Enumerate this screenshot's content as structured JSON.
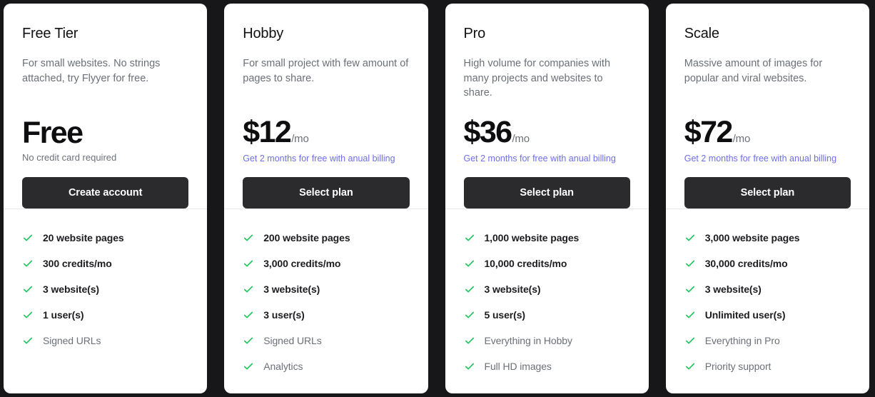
{
  "theme": {
    "page_background": "#17171a",
    "card_background": "#ffffff",
    "button_background": "#2b2b2e",
    "check_color": "#22c55e",
    "link_color": "#6e6ee8",
    "muted_text": "#6b7078",
    "strong_text": "#1c1c20"
  },
  "plans": [
    {
      "name": "Free Tier",
      "description": "For small websites. No strings attached, try Flyyer for free.",
      "price": "Free",
      "period": "",
      "note": "No credit card required",
      "note_style": "muted",
      "cta": "Create account",
      "features": [
        {
          "label": "20 website pages",
          "emphasis": "strong"
        },
        {
          "label": "300 credits/mo",
          "emphasis": "strong"
        },
        {
          "label": "3 website(s)",
          "emphasis": "strong"
        },
        {
          "label": "1 user(s)",
          "emphasis": "strong"
        },
        {
          "label": "Signed URLs",
          "emphasis": "muted"
        }
      ]
    },
    {
      "name": "Hobby",
      "description": "For small project with few amount of pages to share.",
      "price": "$12",
      "period": "/mo",
      "note": "Get 2 months for free with anual billing",
      "note_style": "link",
      "cta": "Select plan",
      "features": [
        {
          "label": "200 website pages",
          "emphasis": "strong"
        },
        {
          "label": "3,000 credits/mo",
          "emphasis": "strong"
        },
        {
          "label": "3 website(s)",
          "emphasis": "strong"
        },
        {
          "label": "3 user(s)",
          "emphasis": "strong"
        },
        {
          "label": "Signed URLs",
          "emphasis": "muted"
        },
        {
          "label": "Analytics",
          "emphasis": "muted"
        }
      ]
    },
    {
      "name": "Pro",
      "description": "High volume for companies with many projects and websites to share.",
      "price": "$36",
      "period": "/mo",
      "note": "Get 2 months for free with anual billing",
      "note_style": "link",
      "cta": "Select plan",
      "features": [
        {
          "label": "1,000 website pages",
          "emphasis": "strong"
        },
        {
          "label": "10,000 credits/mo",
          "emphasis": "strong"
        },
        {
          "label": "3 website(s)",
          "emphasis": "strong"
        },
        {
          "label": "5 user(s)",
          "emphasis": "strong"
        },
        {
          "label": "Everything in Hobby",
          "emphasis": "muted"
        },
        {
          "label": "Full HD images",
          "emphasis": "muted"
        }
      ]
    },
    {
      "name": "Scale",
      "description": "Massive amount of images for popular and viral websites.",
      "price": "$72",
      "period": "/mo",
      "note": "Get 2 months for free with anual billing",
      "note_style": "link",
      "cta": "Select plan",
      "features": [
        {
          "label": "3,000 website pages",
          "emphasis": "strong"
        },
        {
          "label": "30,000 credits/mo",
          "emphasis": "strong"
        },
        {
          "label": "3 website(s)",
          "emphasis": "strong"
        },
        {
          "label": "Unlimited user(s)",
          "emphasis": "strong"
        },
        {
          "label": "Everything in Pro",
          "emphasis": "muted"
        },
        {
          "label": "Priority support",
          "emphasis": "muted"
        }
      ]
    }
  ],
  "icons": {
    "check": "check-icon"
  }
}
